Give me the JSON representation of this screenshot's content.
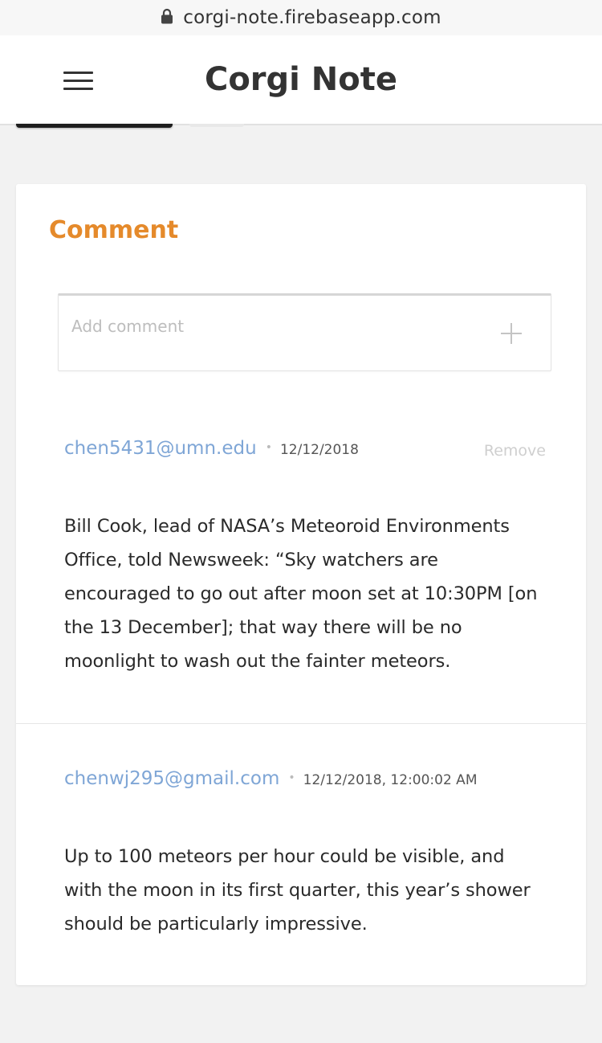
{
  "browser": {
    "url": "corgi-note.firebaseapp.com"
  },
  "header": {
    "title": "Corgi Note",
    "menu_icon": "hamburger-menu-icon"
  },
  "comment_section": {
    "title": "Comment",
    "input": {
      "placeholder": "Add comment",
      "value": ""
    },
    "add_icon": "plus-icon",
    "colors": {
      "title": "#e58a2b",
      "author": "#7fa6d6"
    },
    "comments": [
      {
        "author": "chen5431@umn.edu",
        "separator": "•",
        "date": "12/12/2018",
        "remove_label": "Remove",
        "body": "Bill Cook, lead of NASA’s Meteoroid Environments Office, told Newsweek: “Sky watchers are encouraged to go out after moon set at 10:30PM [on the 13 December]; that way there will be no moonlight to wash out the fainter meteors."
      },
      {
        "author": "chenwj295@gmail.com",
        "separator": "•",
        "date": "12/12/2018, 12:00:02 AM",
        "body": "Up to 100 meteors per hour could be visible, and with the moon in its first quarter, this year’s shower should be particularly impressive."
      }
    ]
  }
}
